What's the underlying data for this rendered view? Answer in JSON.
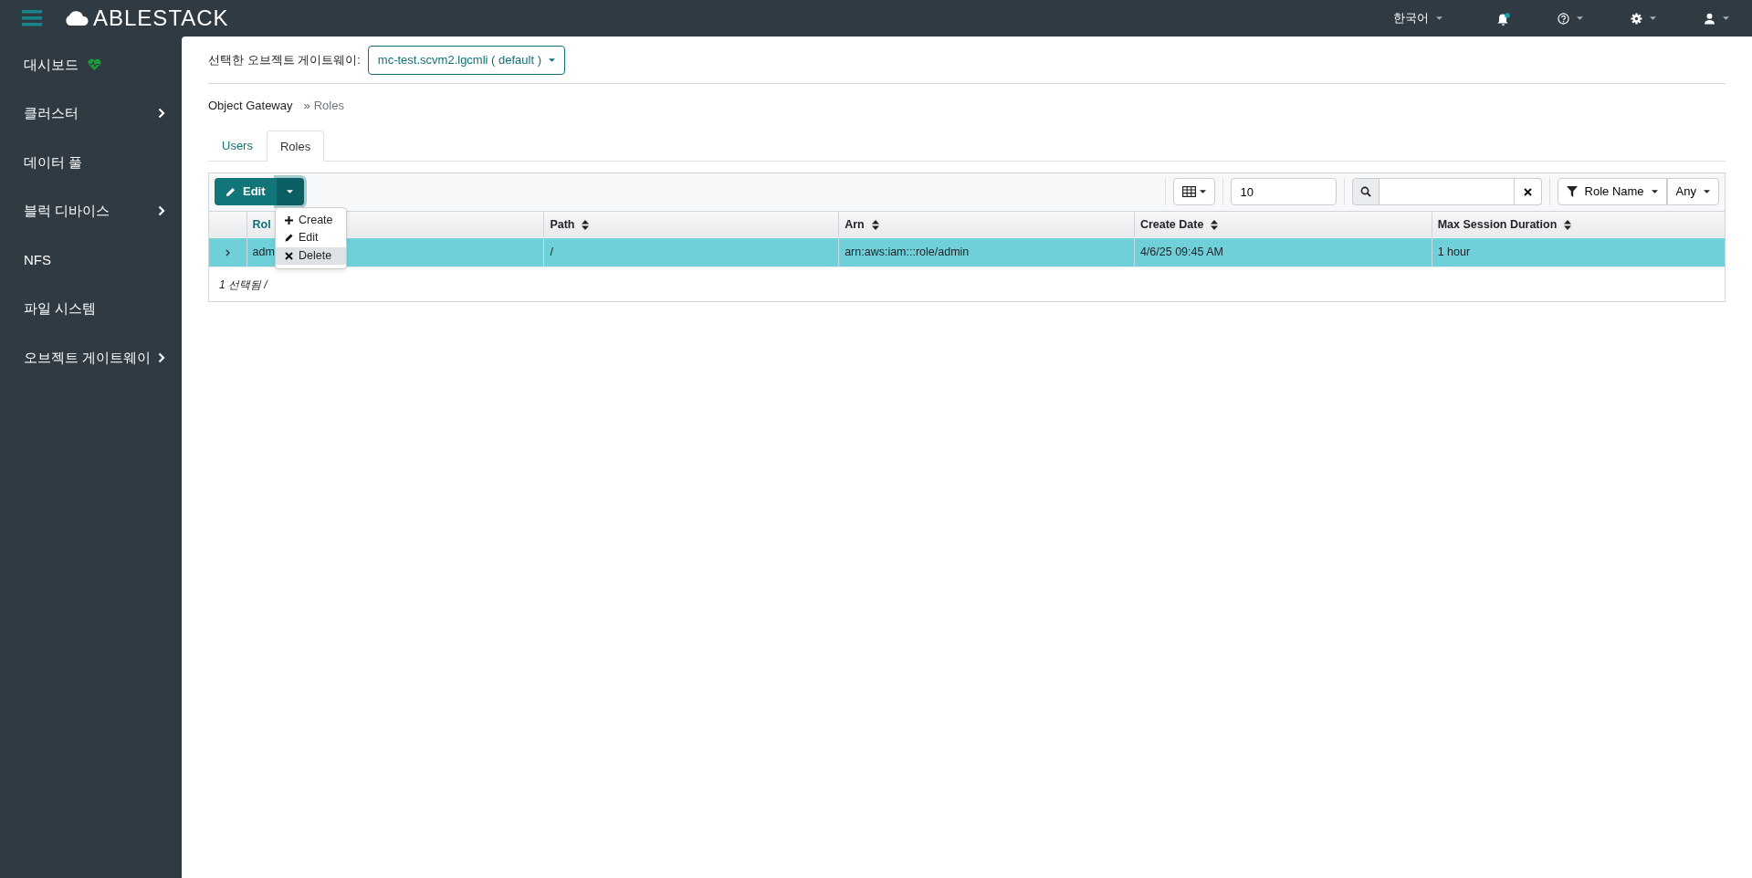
{
  "topbar": {
    "logo": "ABLESTACK",
    "language": "한국어",
    "notifications": {
      "unread": true
    }
  },
  "sidebar": {
    "items": [
      {
        "label": "대시보드",
        "kind": "status",
        "has_children": false
      },
      {
        "label": "클러스터",
        "kind": "menu",
        "has_children": true
      },
      {
        "label": "데이터 풀",
        "kind": "menu",
        "has_children": false
      },
      {
        "label": "블럭 디바이스",
        "kind": "menu",
        "has_children": true
      },
      {
        "label": "NFS",
        "kind": "menu",
        "has_children": false
      },
      {
        "label": "파일 시스템",
        "kind": "menu",
        "has_children": false
      },
      {
        "label": "오브젝트 게이트웨이",
        "kind": "menu",
        "has_children": true
      }
    ]
  },
  "gateway_selector": {
    "label": "선택한 오브젝트 게이트웨이:",
    "value": "mc-test.scvm2.lgcmli ( default )"
  },
  "breadcrumb": {
    "separator": "»",
    "items": [
      "Object Gateway",
      "Roles"
    ]
  },
  "tabs": [
    {
      "label": "Users",
      "selected": false
    },
    {
      "label": "Roles",
      "selected": true
    }
  ],
  "toolbar": {
    "primary_action": "Edit",
    "menu": [
      {
        "label": "Create",
        "kind": "plus",
        "selected": false
      },
      {
        "label": "Edit",
        "kind": "pencil",
        "selected": false
      },
      {
        "label": "Delete",
        "kind": "cross",
        "selected": true
      }
    ],
    "page_size": "10",
    "filter": {
      "column": "Role Name",
      "value": "Any"
    }
  },
  "table": {
    "columns": [
      {
        "label": "Rol",
        "sorted": true
      },
      {
        "label": "Path",
        "sorted": false
      },
      {
        "label": "Arn",
        "sorted": false
      },
      {
        "label": "Create Date",
        "sorted": false
      },
      {
        "label": "Max Session Duration",
        "sorted": false
      }
    ],
    "rows": [
      {
        "selected": true,
        "cells": [
          "adm",
          "/",
          "arn:aws:iam:::role/admin",
          "4/6/25 09:45 AM",
          "1 hour"
        ]
      }
    ],
    "footer": "1 선택됨 /"
  }
}
